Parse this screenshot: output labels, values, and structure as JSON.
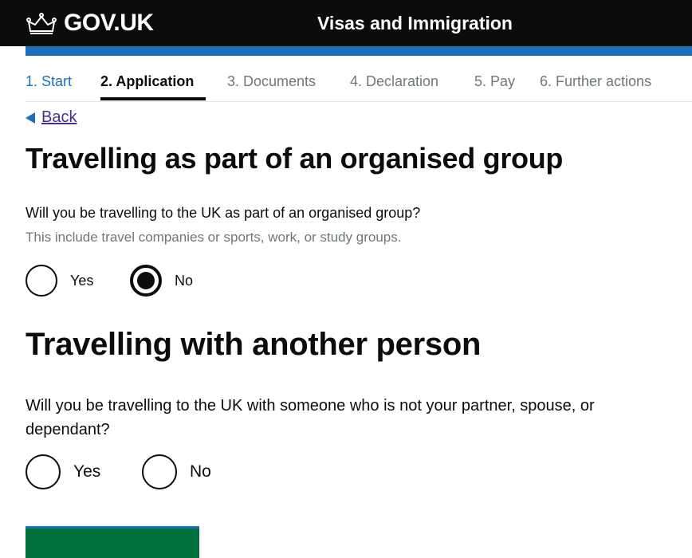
{
  "header": {
    "logo_text": "GOV.UK",
    "service_name": "Visas and Immigration",
    "colors": {
      "background": "#0b0c0c",
      "accent_bar": "#1d70b8"
    }
  },
  "steps": [
    {
      "label": "1. Start",
      "state": "done"
    },
    {
      "label": "2. Application",
      "state": "current"
    },
    {
      "label": "3. Documents",
      "state": "upcoming"
    },
    {
      "label": "4. Declaration",
      "state": "upcoming"
    },
    {
      "label": "5. Pay",
      "state": "upcoming"
    },
    {
      "label": "6. Further actions",
      "state": "upcoming"
    }
  ],
  "back_link": {
    "label": "Back",
    "icon": "triangle-left-icon"
  },
  "group_section": {
    "heading": "Travelling as part of an organised group",
    "question": "Will you be travelling to the UK as part of an organised group?",
    "hint": "This include travel companies or sports, work, or study groups.",
    "options": [
      {
        "label": "Yes",
        "checked": false
      },
      {
        "label": "No",
        "checked": true
      }
    ]
  },
  "person_section": {
    "heading": "Travelling with another person",
    "question": "Will you be travelling to the UK with someone who is not your partner, spouse, or dependant?",
    "options": [
      {
        "label": "Yes",
        "checked": false
      },
      {
        "label": "No",
        "checked": false
      }
    ]
  }
}
